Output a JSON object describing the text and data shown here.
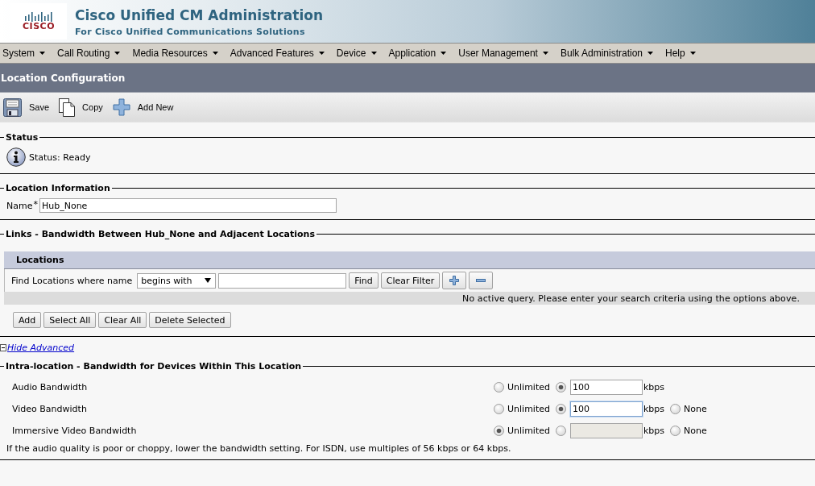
{
  "header": {
    "logo_text": "CISCO",
    "title": "Cisco Unified CM Administration",
    "subtitle": "For Cisco Unified Communications Solutions"
  },
  "menu": [
    "System",
    "Call Routing",
    "Media Resources",
    "Advanced Features",
    "Device",
    "Application",
    "User Management",
    "Bulk Administration",
    "Help"
  ],
  "page_title": "Location Configuration",
  "toolbar": [
    {
      "kind": "save",
      "label": "Save"
    },
    {
      "kind": "copy",
      "label": "Copy"
    },
    {
      "kind": "add",
      "label": "Add New"
    }
  ],
  "status": {
    "legend": "Status",
    "message": "Status: Ready"
  },
  "location_information": {
    "legend": "Location Information",
    "name_label": "Name",
    "required_mark": "*",
    "name_value": "Hub_None"
  },
  "links": {
    "legend": "Links - Bandwidth Between Hub_None and Adjacent Locations",
    "panel_title": "Locations",
    "find_label": "Find Locations where name",
    "match_option": "begins with",
    "find_button": "Find",
    "clear_filter_button": "Clear Filter",
    "message": "No active query. Please enter your search criteria using the options above.",
    "actions": [
      "Add",
      "Select All",
      "Clear All",
      "Delete Selected"
    ]
  },
  "hide_advanced_link": "Hide Advanced",
  "intra_location": {
    "legend": "Intra-location - Bandwidth for Devices Within This Location",
    "rows": [
      {
        "label": "Audio Bandwidth",
        "options": [
          {
            "kind": "unlimited",
            "label": "Unlimited",
            "selected": false
          },
          {
            "kind": "limit",
            "value": "100",
            "unit": "kbps",
            "selected": true,
            "disabled": false,
            "focused": false
          }
        ]
      },
      {
        "label": "Video Bandwidth",
        "options": [
          {
            "kind": "unlimited",
            "label": "Unlimited",
            "selected": false
          },
          {
            "kind": "limit",
            "value": "100",
            "unit": "kbps",
            "selected": true,
            "disabled": false,
            "focused": true
          },
          {
            "kind": "none",
            "label": "None",
            "selected": false
          }
        ]
      },
      {
        "label": "Immersive Video Bandwidth",
        "options": [
          {
            "kind": "unlimited",
            "label": "Unlimited",
            "selected": true
          },
          {
            "kind": "limit",
            "unit": "kbps",
            "selected": false,
            "disabled": true,
            "focused": false
          },
          {
            "kind": "none",
            "label": "None",
            "selected": false
          }
        ]
      }
    ],
    "note": "If the audio quality is poor or choppy, lower the bandwidth setting. For ISDN, use multiples of 56 kbps or 64 kbps."
  }
}
